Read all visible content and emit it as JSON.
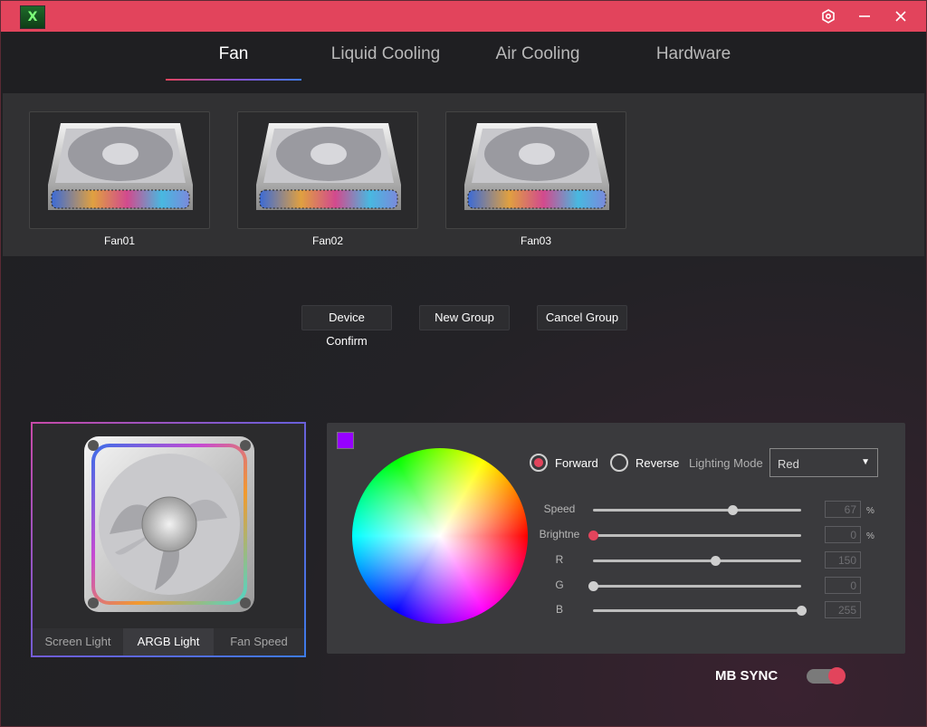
{
  "titlebar": {
    "logo": "X",
    "icons": [
      "settings-icon",
      "minimize-icon",
      "close-icon"
    ],
    "accent_color": "#e2445c"
  },
  "nav": {
    "tabs": [
      {
        "label": "Fan",
        "active": true
      },
      {
        "label": "Liquid Cooling",
        "active": false
      },
      {
        "label": "Air Cooling",
        "active": false
      },
      {
        "label": "Hardware",
        "active": false
      }
    ]
  },
  "devices": [
    {
      "name": "Fan01"
    },
    {
      "name": "Fan02"
    },
    {
      "name": "Fan03"
    }
  ],
  "actions": {
    "device_confirm": "Device Confirm",
    "new_group": "New Group",
    "cancel_group": "Cancel Group"
  },
  "preview": {
    "modes": [
      {
        "label": "Screen Light",
        "active": false
      },
      {
        "label": "ARGB Light",
        "active": true
      },
      {
        "label": "Fan Speed",
        "active": false
      }
    ]
  },
  "lighting": {
    "swatch_color": "#9600ff",
    "direction": {
      "forward": "Forward",
      "reverse": "Reverse",
      "selected": "forward"
    },
    "mode_label": "Lighting Mode",
    "mode_value": "Red",
    "sliders": [
      {
        "label": "Speed",
        "value": "67",
        "unit": "%",
        "max": 100,
        "thumb": "gray"
      },
      {
        "label": "Brightne",
        "value": "0",
        "unit": "%",
        "max": 100,
        "thumb": "red"
      },
      {
        "label": "R",
        "value": "150",
        "unit": "",
        "max": 255,
        "thumb": "gray"
      },
      {
        "label": "G",
        "value": "0",
        "unit": "",
        "max": 255,
        "thumb": "gray"
      },
      {
        "label": "B",
        "value": "255",
        "unit": "",
        "max": 255,
        "thumb": "gray"
      }
    ]
  },
  "mb_sync": {
    "label": "MB SYNC",
    "enabled": true
  }
}
